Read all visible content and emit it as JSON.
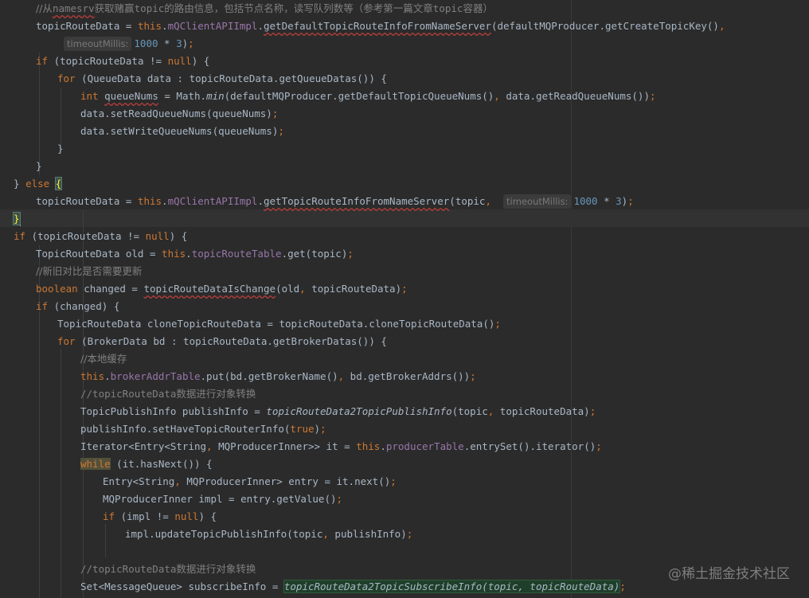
{
  "editor": {
    "lines": [
      [
        {
          "t": "//从",
          "c": "cmcn"
        },
        {
          "t": "namesrv",
          "c": "cm squig"
        },
        {
          "t": "获取赌赢",
          "c": "cmcn"
        },
        {
          "t": "topic",
          "c": "cm"
        },
        {
          "t": "的路由信息，包括节点名称，读写队列数等（参考第一篇文章",
          "c": "cmcn"
        },
        {
          "t": "topic",
          "c": "cm"
        },
        {
          "t": "容器）",
          "c": "cmcn"
        }
      ],
      [
        {
          "t": "topicRouteData = "
        },
        {
          "t": "this",
          "c": "kw"
        },
        {
          "t": "."
        },
        {
          "t": "mQClientAPIImpl",
          "c": "fld"
        },
        {
          "t": "."
        },
        {
          "t": "getDefaultTopicRouteInfoFromNameServer",
          "c": "squig"
        },
        {
          "t": "(defaultMQProducer.getCreateTopicKey()"
        },
        {
          "t": ",",
          "c": "kw"
        }
      ],
      [
        {
          "t": "timeoutMillis:",
          "c": "hint"
        },
        {
          "t": "1000",
          "c": "num"
        },
        {
          "t": " * "
        },
        {
          "t": "3",
          "c": "num"
        },
        {
          "t": ")"
        },
        {
          "t": ";",
          "c": "kw"
        }
      ],
      [
        {
          "t": "if",
          "c": "kw"
        },
        {
          "t": " (topicRouteData != "
        },
        {
          "t": "null",
          "c": "kw"
        },
        {
          "t": ") {"
        }
      ],
      [
        {
          "t": "for",
          "c": "kw"
        },
        {
          "t": " (QueueData data : topicRouteData.getQueueDatas()) {"
        }
      ],
      [
        {
          "t": "int",
          "c": "kw"
        },
        {
          "t": " "
        },
        {
          "t": "queueNums",
          "c": "squig"
        },
        {
          "t": " = Math."
        },
        {
          "t": "min",
          "c": "it"
        },
        {
          "t": "(defaultMQProducer.getDefaultTopicQueueNums()"
        },
        {
          "t": ",",
          "c": "kw"
        },
        {
          "t": " data.getReadQueueNums())"
        },
        {
          "t": ";",
          "c": "kw"
        }
      ],
      [
        {
          "t": "data.setReadQueueNums(queueNums)"
        },
        {
          "t": ";",
          "c": "kw"
        }
      ],
      [
        {
          "t": "data.setWriteQueueNums(queueNums)"
        },
        {
          "t": ";",
          "c": "kw"
        }
      ],
      [
        {
          "t": "}"
        }
      ],
      [
        {
          "t": "}"
        }
      ],
      [
        {
          "t": "} "
        },
        {
          "t": "else",
          "c": "kw"
        },
        {
          "t": " "
        },
        {
          "t": "{",
          "c": "brace-hl"
        }
      ],
      [
        {
          "t": "topicRouteData = "
        },
        {
          "t": "this",
          "c": "kw"
        },
        {
          "t": "."
        },
        {
          "t": "mQClientAPIImpl",
          "c": "fld"
        },
        {
          "t": "."
        },
        {
          "t": "getTopicRouteInfoFromNameServer",
          "c": "squig"
        },
        {
          "t": "(topic"
        },
        {
          "t": ",",
          "c": "kw"
        },
        {
          "t": "  "
        },
        {
          "t": "timeoutMillis:",
          "c": "hint"
        },
        {
          "t": "1000",
          "c": "num"
        },
        {
          "t": " * "
        },
        {
          "t": "3",
          "c": "num"
        },
        {
          "t": ")"
        },
        {
          "t": ";",
          "c": "kw"
        }
      ],
      [
        {
          "t": "}",
          "c": "brace-hl"
        },
        {
          "t": "",
          "c": "caret"
        }
      ],
      [
        {
          "t": "if",
          "c": "kw"
        },
        {
          "t": " (topicRouteData != "
        },
        {
          "t": "null",
          "c": "kw"
        },
        {
          "t": ") {"
        }
      ],
      [
        {
          "t": "TopicRouteData old = "
        },
        {
          "t": "this",
          "c": "kw"
        },
        {
          "t": "."
        },
        {
          "t": "topicRouteTable",
          "c": "fld"
        },
        {
          "t": ".get(topic)"
        },
        {
          "t": ";",
          "c": "kw"
        }
      ],
      [
        {
          "t": "//新旧对比是否需要更新",
          "c": "cmcn"
        }
      ],
      [
        {
          "t": "boolean",
          "c": "kw"
        },
        {
          "t": " changed = "
        },
        {
          "t": "topicRouteDataIsChange",
          "c": "squig"
        },
        {
          "t": "(old"
        },
        {
          "t": ",",
          "c": "kw"
        },
        {
          "t": " topicRouteData)"
        },
        {
          "t": ";",
          "c": "kw"
        }
      ],
      [
        {
          "t": "if",
          "c": "kw"
        },
        {
          "t": " (changed) {"
        }
      ],
      [
        {
          "t": "TopicRouteData cloneTopicRouteData = topicRouteData.cloneTopicRouteData()"
        },
        {
          "t": ";",
          "c": "kw"
        }
      ],
      [
        {
          "t": "for",
          "c": "kw"
        },
        {
          "t": " (BrokerData bd : topicRouteData.getBrokerDatas()) {"
        }
      ],
      [
        {
          "t": "//本地缓存",
          "c": "cmcn"
        }
      ],
      [
        {
          "t": "this",
          "c": "kw"
        },
        {
          "t": "."
        },
        {
          "t": "brokerAddrTable",
          "c": "fld"
        },
        {
          "t": ".put(bd.getBrokerName()"
        },
        {
          "t": ",",
          "c": "kw"
        },
        {
          "t": " bd.getBrokerAddrs())"
        },
        {
          "t": ";",
          "c": "kw"
        }
      ],
      [
        {
          "t": "//topicRouteData",
          "c": "cm"
        },
        {
          "t": "数据进行对象转换",
          "c": "cmcn"
        }
      ],
      [
        {
          "t": "TopicPublishInfo publishInfo = "
        },
        {
          "t": "topicRouteData2TopicPublishInfo",
          "c": "it"
        },
        {
          "t": "(topic"
        },
        {
          "t": ",",
          "c": "kw"
        },
        {
          "t": " topicRouteData)"
        },
        {
          "t": ";",
          "c": "kw"
        }
      ],
      [
        {
          "t": "publishInfo.setHaveTopicRouterInfo("
        },
        {
          "t": "true",
          "c": "kw"
        },
        {
          "t": ")"
        },
        {
          "t": ";",
          "c": "kw"
        }
      ],
      [
        {
          "t": "Iterator<Entry<String"
        },
        {
          "t": ",",
          "c": "kw"
        },
        {
          "t": " MQProducerInner>> it = "
        },
        {
          "t": "this",
          "c": "kw"
        },
        {
          "t": "."
        },
        {
          "t": "producerTable",
          "c": "fld"
        },
        {
          "t": ".entrySet().iterator()"
        },
        {
          "t": ";",
          "c": "kw"
        }
      ],
      [
        {
          "t": "while",
          "c": "kw while-hl"
        },
        {
          "t": " (it.hasNext()) {"
        }
      ],
      [
        {
          "t": "Entry<String"
        },
        {
          "t": ",",
          "c": "kw"
        },
        {
          "t": " MQProducerInner> entry = it.next()"
        },
        {
          "t": ";",
          "c": "kw"
        }
      ],
      [
        {
          "t": "MQProducerInner impl = entry.getValue()"
        },
        {
          "t": ";",
          "c": "kw"
        }
      ],
      [
        {
          "t": "if",
          "c": "kw"
        },
        {
          "t": " (impl != "
        },
        {
          "t": "null",
          "c": "kw"
        },
        {
          "t": ") {"
        }
      ],
      [
        {
          "t": "impl.updateTopicPublishInfo(topic"
        },
        {
          "t": ",",
          "c": "kw"
        },
        {
          "t": " publishInfo)"
        },
        {
          "t": ";",
          "c": "kw"
        }
      ],
      [],
      [
        {
          "t": "//topicRouteData",
          "c": "cm"
        },
        {
          "t": "数据进行对象转换",
          "c": "cmcn"
        }
      ],
      [
        {
          "t": "Set<MessageQueue> subscribeInfo = "
        },
        {
          "t": "topicRouteData2TopicSubscribeInfo(topic, topicRouteData)",
          "c": "it green-hl"
        },
        {
          "t": ";",
          "c": "kw"
        }
      ]
    ]
  },
  "watermark": "@稀土掘金技术社区"
}
